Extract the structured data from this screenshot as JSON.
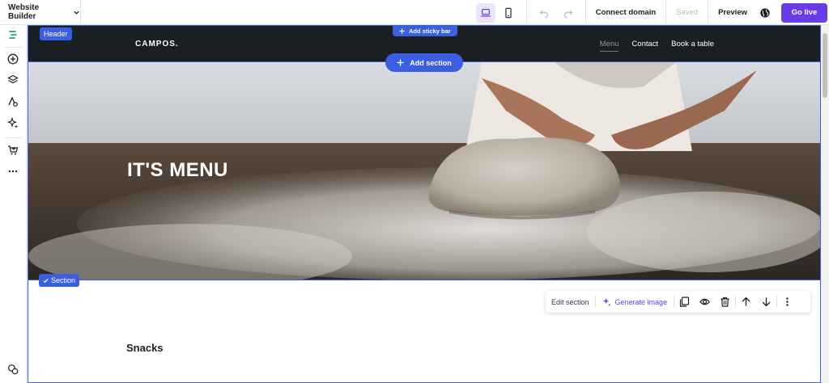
{
  "topbar": {
    "brand_label": "Website Builder",
    "connect_domain": "Connect domain",
    "saved": "Saved",
    "preview": "Preview",
    "go_live": "Go live"
  },
  "canvas": {
    "header_tag": "Header",
    "add_sticky_bar": "Add sticky bar",
    "add_section": "Add section",
    "site": {
      "logo": "CAMPOS.",
      "nav": [
        "Menu",
        "Contact",
        "Book a table"
      ]
    },
    "hero_title": "IT'S MENU",
    "section_tag": "Section",
    "section_toolbar": {
      "edit_section": "Edit section",
      "generate_image": "Generate image"
    },
    "snacks_heading": "Snacks"
  },
  "colors": {
    "accent": "#673de6",
    "selection": "#3b5fe0",
    "header_bg": "#1a1f24"
  }
}
